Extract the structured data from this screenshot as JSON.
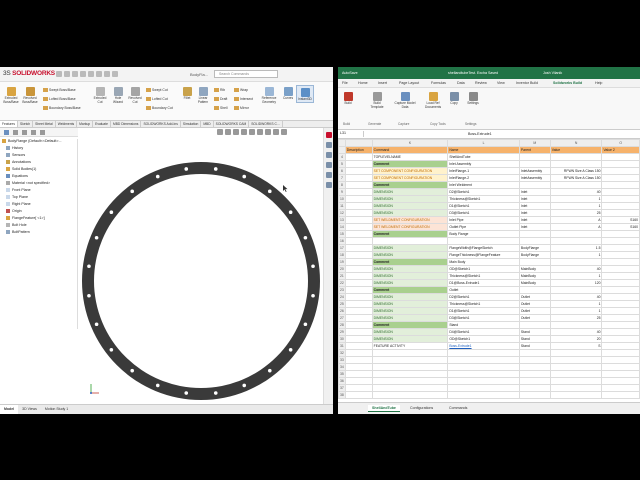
{
  "solidworks": {
    "logo_brand": "3S SOLIDWORKS",
    "file_name": "BodyFla...",
    "search_placeholder": "Search Commands",
    "ribbon": {
      "big_buttons": [
        "Extruded Boss/Base",
        "Revolved Boss/Base",
        "Extruded Cut",
        "Hole Wizard",
        "Revolved Cut",
        "Fillet",
        "Linear Pattern",
        "Reference Geometry",
        "Curves",
        "Instant3D"
      ],
      "small_buttons": [
        "Swept Boss/Base",
        "Lofted Boss/Base",
        "Boundary Boss/Base",
        "Swept Cut",
        "Lofted Cut",
        "Boundary Cut",
        "Rib",
        "Draft",
        "Shell",
        "Wrap",
        "Intersect",
        "Mirror"
      ]
    },
    "tabs": [
      "Features",
      "Sketch",
      "Sheet Metal",
      "Weldments",
      "Markup",
      "Evaluate",
      "MBD Dimensions",
      "SOLIDWORKS Add-Ins",
      "Simulation",
      "MBD",
      "SOLIDWORKS CAM",
      "SOLIDWORKS C..."
    ],
    "tree": [
      "BodyFlange (Default<<Default>...",
      "History",
      "Sensors",
      "Annotations",
      "Solid Bodies(1)",
      "Equations",
      "Material <not specified>",
      "Front Plane",
      "Top Plane",
      "Right Plane",
      "Origin",
      "FlangeFeature[ <1>]",
      "Bolt Hole",
      "BoltPattern"
    ],
    "bottom_tabs": [
      "Model",
      "3D Views",
      "Motion Study 1"
    ]
  },
  "excel": {
    "autosave": "AutoSave",
    "file_name": "shellandtubeTest.  Excha  Saved",
    "user": "Josh Vilanik",
    "menu": [
      "File",
      "Home",
      "Insert",
      "Page Layout",
      "Formulas",
      "Data",
      "Review",
      "View",
      "Inventor Build",
      "Solidworks Build",
      "Help"
    ],
    "ribbon_buttons": [
      "Build",
      "Build Template",
      "Capture Model Data",
      "Load Ref Documents",
      "Copy",
      "Settings"
    ],
    "ribbon_groups": [
      "Build",
      "Generate",
      "Capture",
      "Copy Tools",
      "Settings"
    ],
    "name_box": "L31",
    "formula": "Boss-Extrude1",
    "columns": [
      "K",
      "L",
      "M",
      "N",
      "O"
    ],
    "headers": [
      "Description",
      "Command",
      "Name",
      "Parent",
      "Value",
      "Value 2"
    ],
    "rows": [
      {
        "n": "4",
        "b": "",
        "c": "TOPLEVELNAME",
        "l": "ShellAndTube",
        "m": "",
        "v": "",
        "v2": "",
        "t": "plain"
      },
      {
        "n": "5",
        "b": "",
        "c": "Comment",
        "l": "Inlet Assembly",
        "m": "",
        "v": "",
        "v2": "",
        "t": "cmt"
      },
      {
        "n": "6",
        "b": "",
        "c": "SET COMPONENT CONFIGURATION",
        "l": "InletFlange-1",
        "m": "InletAssembly",
        "v": "RFWN Size A Class 150",
        "v2": "",
        "t": "cfg"
      },
      {
        "n": "7",
        "b": "",
        "c": "SET COMPONENT CONFIGURATION",
        "l": "InletFlange-2",
        "m": "InletAssembly",
        "v": "RFWN Size A Class 150",
        "v2": "",
        "t": "cfg"
      },
      {
        "n": "8",
        "b": "",
        "c": "Comment",
        "l": "Inlet Weldment",
        "m": "",
        "v": "",
        "v2": "",
        "t": "cmt"
      },
      {
        "n": "9",
        "b": "",
        "c": "DIMENSION",
        "l": "D2@Sketch1",
        "m": "Inlet",
        "v": "40",
        "v2": "",
        "t": "dim"
      },
      {
        "n": "10",
        "b": "",
        "c": "DIMENSION",
        "l": "Thickness@Sketch1",
        "m": "Inlet",
        "v": "1",
        "v2": "",
        "t": "dim"
      },
      {
        "n": "11",
        "b": "",
        "c": "DIMENSION",
        "l": "D1@Sketch1",
        "m": "Inlet",
        "v": "1",
        "v2": "",
        "t": "dim"
      },
      {
        "n": "12",
        "b": "",
        "c": "DIMENSION",
        "l": "D3@Sketch1",
        "m": "Inlet",
        "v": "25",
        "v2": "",
        "t": "dim"
      },
      {
        "n": "13",
        "b": "",
        "c": "SET WELDMENT CONFIGURATION",
        "l": "Inlet Pipe",
        "m": "Inlet",
        "v": "A",
        "v2": "S160",
        "t": "wld"
      },
      {
        "n": "14",
        "b": "",
        "c": "SET WELDMENT CONFIGURATION",
        "l": "Outlet Pipe",
        "m": "Inlet",
        "v": "A",
        "v2": "S160",
        "t": "wld"
      },
      {
        "n": "15",
        "b": "",
        "c": "Comment",
        "l": "Body Flange",
        "m": "",
        "v": "",
        "v2": "",
        "t": "cmt"
      },
      {
        "n": "16",
        "b": "",
        "c": "",
        "l": "",
        "m": "",
        "v": "",
        "v2": "",
        "t": "plain"
      },
      {
        "n": "17",
        "b": "",
        "c": "DIMENSION",
        "l": "FlangeWidth@FlangeSketch",
        "m": "BodyFlange",
        "v": "1.5",
        "v2": "",
        "t": "dim"
      },
      {
        "n": "18",
        "b": "",
        "c": "DIMENSION",
        "l": "FlangeThickness@FlangeFeature",
        "m": "BodyFlange",
        "v": "1",
        "v2": "",
        "t": "dim"
      },
      {
        "n": "19",
        "b": "",
        "c": "Comment",
        "l": "Main Body",
        "m": "",
        "v": "",
        "v2": "",
        "t": "cmt"
      },
      {
        "n": "20",
        "b": "",
        "c": "DIMENSION",
        "l": "OD@Sketch1",
        "m": "MainBody",
        "v": "40",
        "v2": "",
        "t": "dim"
      },
      {
        "n": "21",
        "b": "",
        "c": "DIMENSION",
        "l": "Thickness@Sketch1",
        "m": "MainBody",
        "v": "1",
        "v2": "",
        "t": "dim"
      },
      {
        "n": "22",
        "b": "",
        "c": "DIMENSION",
        "l": "D1@Boss-Extrude1",
        "m": "MainBody",
        "v": "120",
        "v2": "",
        "t": "dim"
      },
      {
        "n": "23",
        "b": "",
        "c": "Comment",
        "l": "Outlet",
        "m": "",
        "v": "",
        "v2": "",
        "t": "cmt"
      },
      {
        "n": "24",
        "b": "",
        "c": "DIMENSION",
        "l": "D2@Sketch1",
        "m": "Outlet",
        "v": "40",
        "v2": "",
        "t": "dim"
      },
      {
        "n": "25",
        "b": "",
        "c": "DIMENSION",
        "l": "Thickness@Sketch1",
        "m": "Outlet",
        "v": "1",
        "v2": "",
        "t": "dim"
      },
      {
        "n": "26",
        "b": "",
        "c": "DIMENSION",
        "l": "D1@Sketch1",
        "m": "Outlet",
        "v": "1",
        "v2": "",
        "t": "dim"
      },
      {
        "n": "27",
        "b": "",
        "c": "DIMENSION",
        "l": "D3@Sketch1",
        "m": "Outlet",
        "v": "25",
        "v2": "",
        "t": "dim"
      },
      {
        "n": "28",
        "b": "",
        "c": "Comment",
        "l": "Stand",
        "m": "",
        "v": "",
        "v2": "",
        "t": "cmt"
      },
      {
        "n": "29",
        "b": "",
        "c": "DIMENSION",
        "l": "D4@Sketch1",
        "m": "Stand",
        "v": "40",
        "v2": "",
        "t": "dim"
      },
      {
        "n": "30",
        "b": "",
        "c": "DIMENSION",
        "l": "OD@Sketch1",
        "m": "Stand",
        "v": "20",
        "v2": "",
        "t": "dim"
      },
      {
        "n": "31",
        "b": "",
        "c": "FEATURE ACTIVITY",
        "l": "Boss-Extrude1",
        "m": "Stand",
        "v": "S",
        "v2": "",
        "t": "feat"
      },
      {
        "n": "32",
        "b": "",
        "c": "",
        "l": "",
        "m": "",
        "v": "",
        "v2": "",
        "t": "plain"
      },
      {
        "n": "33",
        "b": "",
        "c": "",
        "l": "",
        "m": "",
        "v": "",
        "v2": "",
        "t": "plain"
      },
      {
        "n": "34",
        "b": "",
        "c": "",
        "l": "",
        "m": "",
        "v": "",
        "v2": "",
        "t": "plain"
      },
      {
        "n": "35",
        "b": "",
        "c": "",
        "l": "",
        "m": "",
        "v": "",
        "v2": "",
        "t": "plain"
      },
      {
        "n": "36",
        "b": "",
        "c": "",
        "l": "",
        "m": "",
        "v": "",
        "v2": "",
        "t": "plain"
      },
      {
        "n": "37",
        "b": "",
        "c": "",
        "l": "",
        "m": "",
        "v": "",
        "v2": "",
        "t": "plain"
      },
      {
        "n": "38",
        "b": "",
        "c": "",
        "l": "",
        "m": "",
        "v": "",
        "v2": "",
        "t": "plain"
      }
    ],
    "sheets": [
      "ShellAndTube",
      "Configurations",
      "Commands"
    ]
  },
  "colors": {
    "excel_green": "#217346",
    "solidworks_red": "#c8102e",
    "header_orange": "#f6b26b",
    "comment_green": "#a9d08e"
  }
}
